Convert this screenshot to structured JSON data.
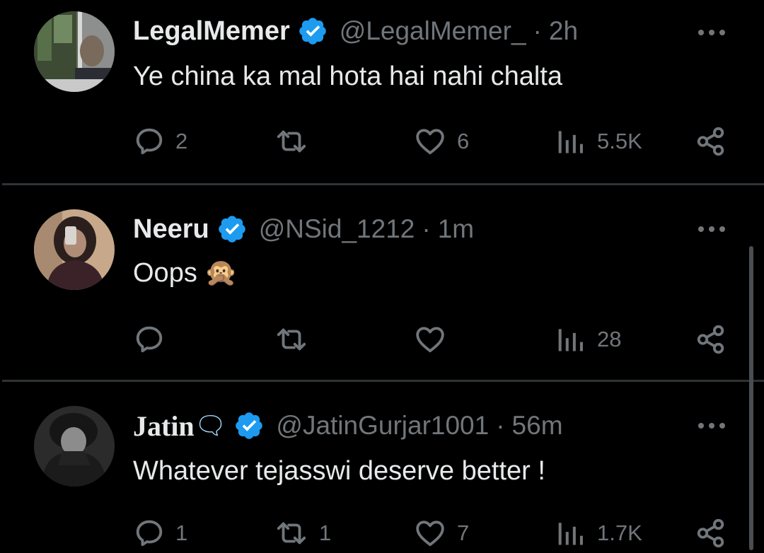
{
  "colors": {
    "background": "#000000",
    "text_primary": "#e7e9ea",
    "text_secondary": "#71767b",
    "verified_blue": "#1d9bf0",
    "divider": "#2f3336"
  },
  "tweets": [
    {
      "name": "LegalMemer",
      "verified": true,
      "handle": "@LegalMemer_",
      "separator": "·",
      "time": "2h",
      "text": "Ye china ka mal hota hai nahi chalta",
      "emoji": "",
      "replies": "2",
      "retweets": "",
      "likes": "6",
      "views": "5.5K",
      "icons": [
        "reply-icon",
        "retweet-icon",
        "like-icon",
        "views-icon",
        "share-icon",
        "more-icon"
      ]
    },
    {
      "name": "Neeru",
      "verified": true,
      "handle": "@NSid_1212",
      "separator": "·",
      "time": "1m",
      "text": "Oops",
      "emoji": "🙊",
      "replies": "",
      "retweets": "",
      "likes": "",
      "views": "28",
      "icons": [
        "reply-icon",
        "retweet-icon",
        "like-icon",
        "views-icon",
        "share-icon",
        "more-icon"
      ]
    },
    {
      "name": "Jatin",
      "name_emoji": "🗨",
      "verified": true,
      "handle": "@JatinGurjar1001",
      "separator": "·",
      "time": "56m",
      "text": "Whatever tejasswi deserve better !",
      "emoji": "",
      "replies": "1",
      "retweets": "1",
      "likes": "7",
      "views": "1.7K",
      "icons": [
        "reply-icon",
        "retweet-icon",
        "like-icon",
        "views-icon",
        "share-icon",
        "more-icon"
      ]
    }
  ]
}
